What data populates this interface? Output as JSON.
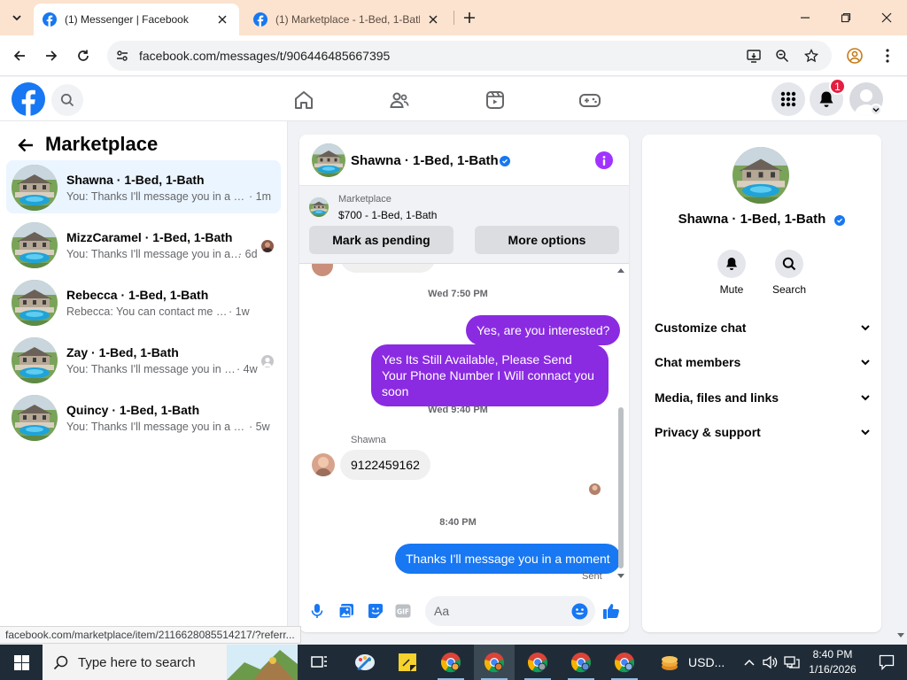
{
  "browser": {
    "tabs": [
      {
        "title": "(1) Messenger | Facebook",
        "active": true
      },
      {
        "title": "(1) Marketplace - 1-Bed, 1-Bath",
        "active": false
      }
    ],
    "url": "facebook.com/messages/t/906446485667395",
    "status_url": "facebook.com/marketplace/item/2116628085514217/?referr..."
  },
  "fb": {
    "notification_count": "1",
    "brand_color": "#1877f2"
  },
  "sidebar": {
    "title": "Marketplace",
    "conversations": [
      {
        "name": "Shawna · 1-Bed, 1-Bath",
        "preview": "You: Thanks I'll message you in a mo...",
        "age": "· 1m",
        "selected": true
      },
      {
        "name": "MizzCaramel · 1-Bed, 1-Bath",
        "preview": "You: Thanks I'll message you in a m...",
        "age": "· 6d"
      },
      {
        "name": "Rebecca · 1-Bed, 1-Bath",
        "preview": "Rebecca: You can contact me here.",
        "age": "· 1w"
      },
      {
        "name": "Zay · 1-Bed, 1-Bath",
        "preview": "You: Thanks I'll message you in a ...",
        "age": "· 4w"
      },
      {
        "name": "Quincy · 1-Bed, 1-Bath",
        "preview": "You: Thanks I'll message you in a mo...",
        "age": "· 5w"
      }
    ]
  },
  "chat": {
    "title": "Shawna · 1-Bed, 1-Bath",
    "listing_label": "Marketplace",
    "listing_price": "$700 - 1-Bed, 1-Bath",
    "mark_pending": "Mark as pending",
    "more_options": "More options",
    "ts1": "Wed 7:50 PM",
    "msg1": "Yes, are you interested?",
    "msg2": "Yes Its Still Available, Please Send Your Phone Number I Will connact you soon",
    "ts2": "Wed 9:40 PM",
    "sender": "Shawna",
    "msg3": "9122459162",
    "ts3": "8:40 PM",
    "msg4": "Thanks I'll message you in a moment",
    "sent_status": "Sent",
    "composer_placeholder": "Aa"
  },
  "info": {
    "name": "Shawna · 1-Bed, 1-Bath",
    "mute": "Mute",
    "search": "Search",
    "sections": [
      "Customize chat",
      "Chat members",
      "Media, files and links",
      "Privacy & support"
    ]
  },
  "taskbar": {
    "search_placeholder": "Type here to search",
    "currency": "USD...",
    "time": "8:40 PM",
    "date": "1/16/2026"
  }
}
